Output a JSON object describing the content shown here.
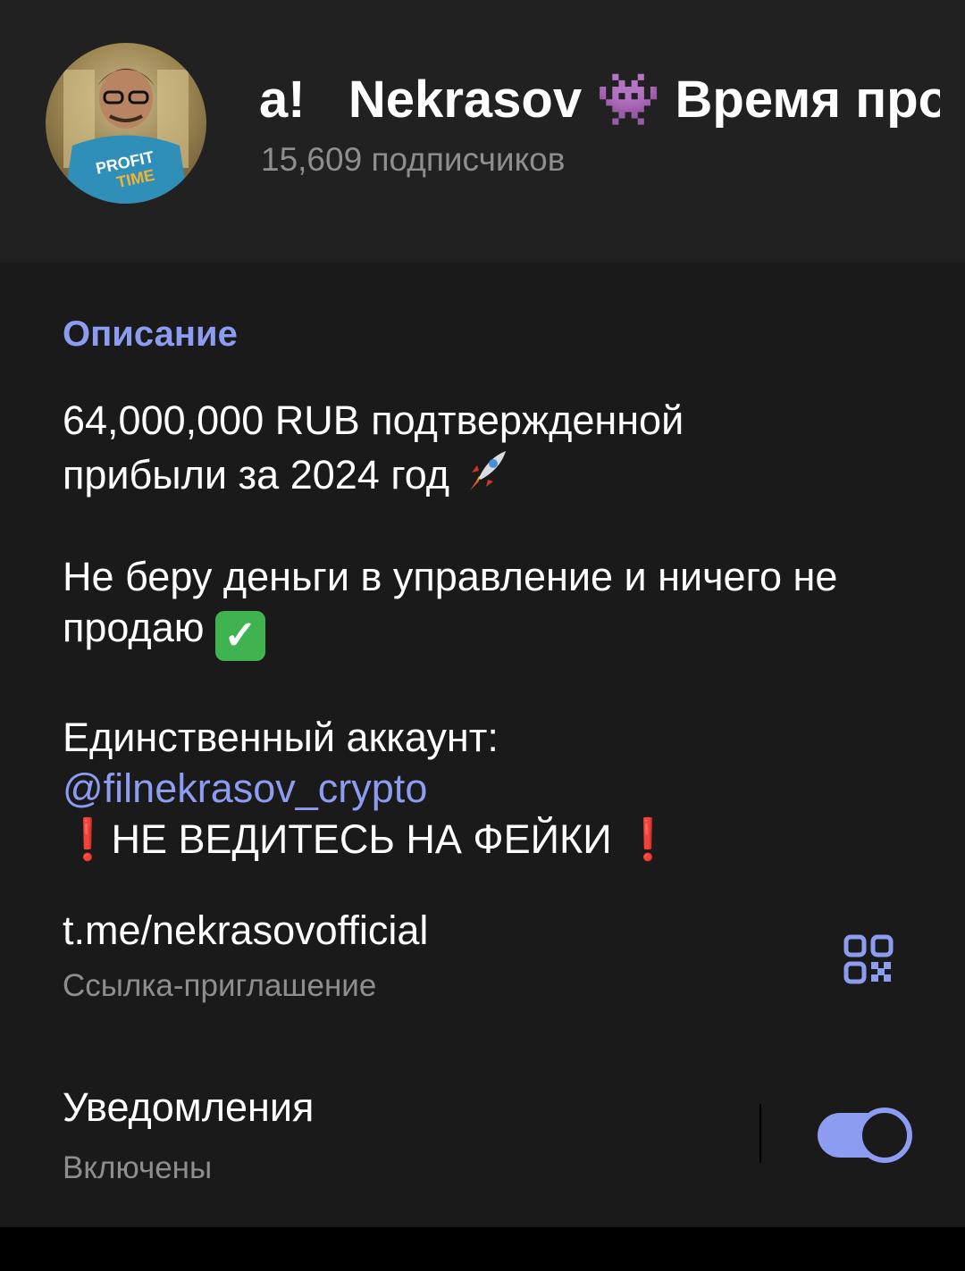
{
  "channel": {
    "title": "а!   Nekrasov 👾 Время профита",
    "subscribers": "15,609 подписчиков",
    "avatar_text": "PROFIT TIME"
  },
  "description": {
    "label": "Описание",
    "line1": "64,000,000 RUB подтвержденной",
    "line2": "прибыли за 2024 год",
    "line3": "Не беру деньги в управление и ничего не",
    "line4": "продаю",
    "line5": "Единственный аккаунт:",
    "mention": "@filnekrasov_crypto",
    "warning_mark": "❗",
    "warning": "НЕ ВЕДИТЕСЬ НА ФЕЙКИ",
    "check_mark": "✓"
  },
  "invite": {
    "link": "t.me/nekrasovofficial",
    "label": "Ссылка-приглашение"
  },
  "notifications": {
    "title": "Уведомления",
    "status": "Включены",
    "enabled": true
  },
  "icons": {
    "qr": "qr-code-icon",
    "rocket": "rocket-icon",
    "check": "check-mark-icon",
    "warning": "exclamation-icon"
  },
  "colors": {
    "accent": "#8c9cf0",
    "header_bg": "#212121",
    "info_bg": "#1a1a1a",
    "secondary_text": "#8e8e8e",
    "warning": "#e02424",
    "check": "#3fb34f"
  }
}
